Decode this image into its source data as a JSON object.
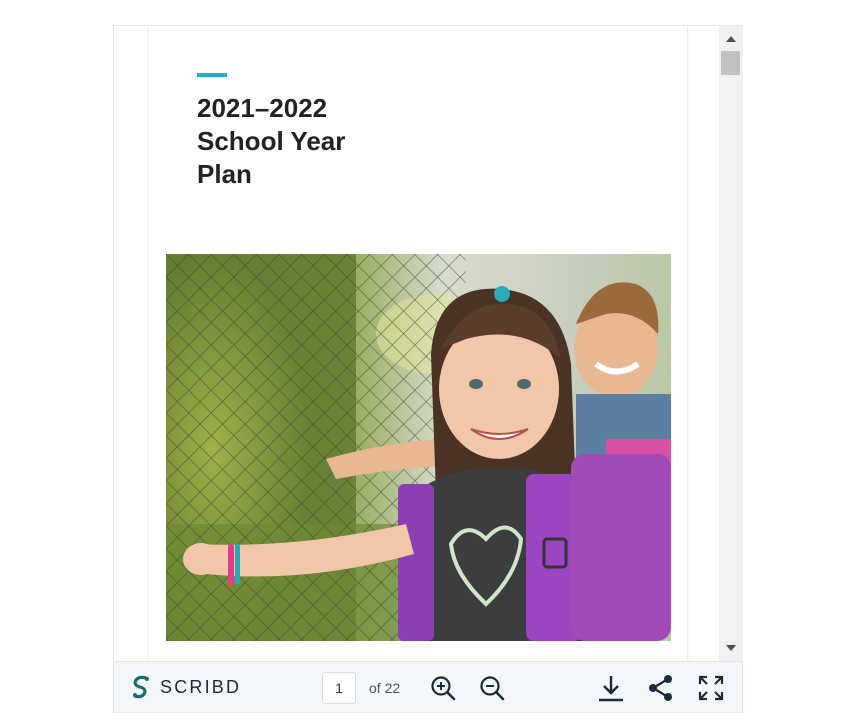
{
  "document": {
    "title_lines": [
      "2021–2022",
      "School Year",
      "Plan"
    ],
    "accent_color": "#1ab0c8",
    "cover_image": "two smiling children with backpacks by a chain-link fence"
  },
  "toolbar": {
    "brand_label": "SCRIBD",
    "brand_icon": "scribd-logo-icon",
    "current_page": "1",
    "page_count_label": "of 22",
    "zoom_in_icon": "zoom-in-icon",
    "zoom_out_icon": "zoom-out-icon",
    "download_icon": "download-icon",
    "share_icon": "share-icon",
    "fullscreen_icon": "fullscreen-icon",
    "background_color": "#f3f6fa",
    "icon_color": "#1e2a3a"
  },
  "scrollbar": {
    "scroll_position": 0.0
  }
}
